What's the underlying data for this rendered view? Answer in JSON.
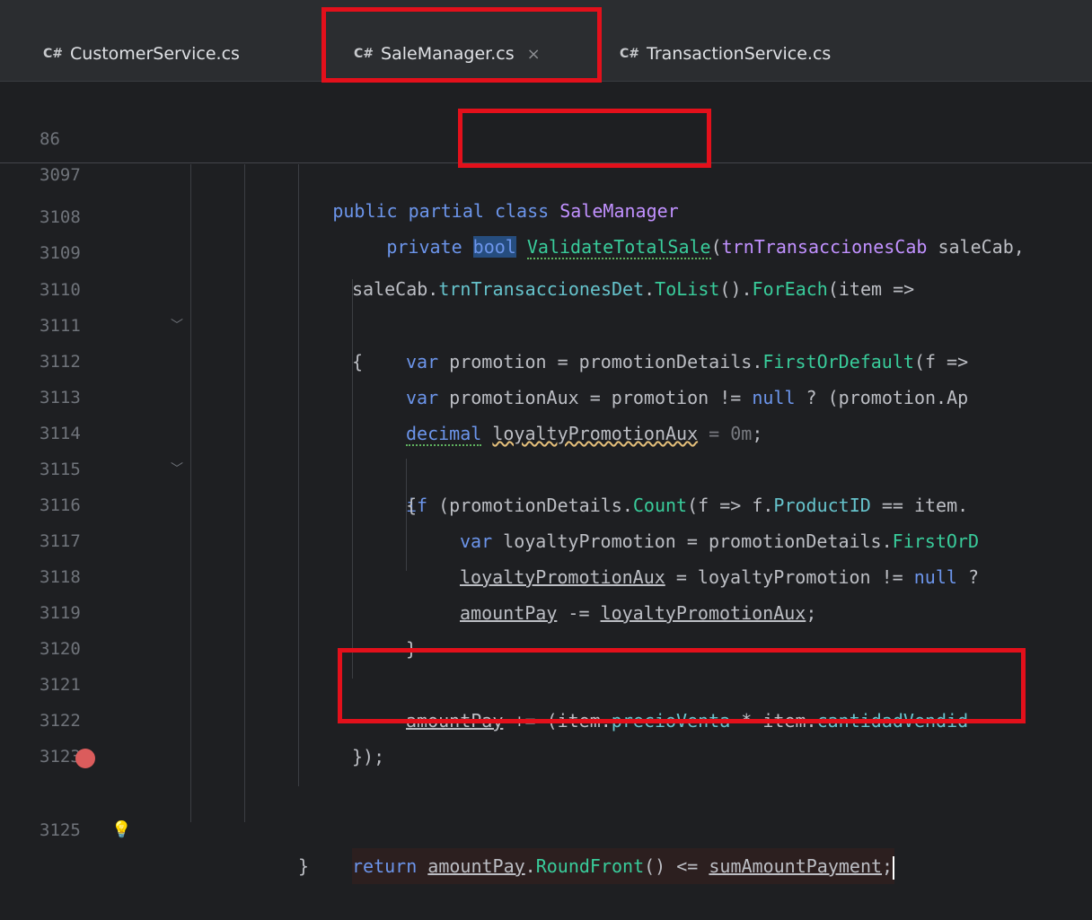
{
  "tabs": [
    {
      "lang": "C#",
      "label": "CustomerService.cs"
    },
    {
      "lang": "C#",
      "label": "SaleManager.cs",
      "close": "×"
    },
    {
      "lang": "C#",
      "label": "TransactionService.cs"
    }
  ],
  "sticky": [
    {
      "num": "86",
      "t": [
        "public",
        " ",
        "partial",
        " ",
        "class",
        " ",
        "SaleManager"
      ]
    },
    {
      "num": "3097",
      "t": [
        "private",
        " ",
        "bool",
        " ",
        "ValidateTotalSale",
        "(",
        "trnTransaccionesCab",
        " saleCab,"
      ]
    }
  ],
  "lines": {
    "l3108": "3108",
    "l3109": "3109",
    "l3110": "3110",
    "l3111": "3111",
    "l3112": "3112",
    "l3113": "3113",
    "l3114": "3114",
    "l3115": "3115",
    "l3116": "3116",
    "l3117": "3117",
    "l3118": "3118",
    "l3119": "3119",
    "l3120": "3120",
    "l3121": "3121",
    "l3122": "3122",
    "l3123": "3123",
    "l3125": "3125"
  },
  "code": {
    "c3109": [
      "saleCab",
      ".",
      "trnTransaccionesDet",
      ".",
      "ToList",
      "().",
      "ForEach",
      "(item =>"
    ],
    "c3110": "{",
    "c3111": [
      "var",
      " promotion = promotionDetails.",
      "FirstOrDefault",
      "(f =>"
    ],
    "c3112": [
      "var",
      " promotionAux = promotion != ",
      "null",
      " ? ",
      "(promotion.Ap"
    ],
    "c3113": [
      "decimal",
      " ",
      "loyaltyPromotionAux",
      " = ",
      "0m",
      ";"
    ],
    "c3114": [
      "if",
      " (promotionDetails.",
      "Count",
      "(f => f.",
      "ProductID",
      " == item."
    ],
    "c3115": "{",
    "c3116": [
      "var",
      " loyaltyPromotion = promotionDetails.",
      "FirstOrD"
    ],
    "c3117": [
      "loyaltyPromotionAux",
      " = loyaltyPromotion != ",
      "null",
      " ?"
    ],
    "c3118": [
      "amountPay",
      " -= ",
      "loyaltyPromotionAux",
      ";"
    ],
    "c3119": "}",
    "c3121": [
      "amountPay",
      " += (item.",
      "precioVenta",
      " * item.",
      "cantidadVendid"
    ],
    "c3122": "});",
    "c3124": [
      "return",
      " ",
      "amountPay",
      ".",
      "RoundFront",
      "() <= ",
      "sumAmountPayment",
      ";"
    ],
    "c3125": "}"
  },
  "colors": {
    "highlight_box": "#e3101b",
    "breakpoint": "#db5c5c",
    "keyword": "#6c95eb",
    "method": "#39cc9b"
  },
  "icons": [
    "breakpoint-icon",
    "lightbulb-icon",
    "fold-chevron-icon",
    "close-icon"
  ]
}
